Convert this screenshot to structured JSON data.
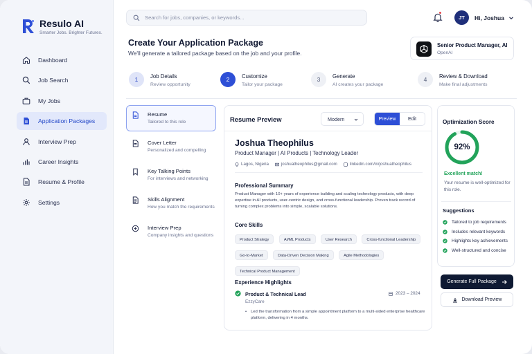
{
  "brand": {
    "name": "Resulo AI",
    "tagline": "Smarter Jobs. Brighter Futures.",
    "accent": "#2e4fd6"
  },
  "nav": [
    {
      "label": "Dashboard",
      "icon": "home-icon"
    },
    {
      "label": "Job Search",
      "icon": "search-icon"
    },
    {
      "label": "My Jobs",
      "icon": "briefcase-icon"
    },
    {
      "label": "Application Packages",
      "icon": "document-icon",
      "active": true
    },
    {
      "label": "Interview Prep",
      "icon": "user-icon"
    },
    {
      "label": "Career Insights",
      "icon": "bar-chart-icon"
    },
    {
      "label": "Resume & Profile",
      "icon": "file-text-icon"
    },
    {
      "label": "Settings",
      "icon": "gear-icon"
    }
  ],
  "header": {
    "search_placeholder": "Search for jobs, companies, or keywords...",
    "avatar_initials": "JT",
    "greeting": "Hi, Joshua"
  },
  "page": {
    "title": "Create Your Application Package",
    "subtitle": "We'll generate a tailored package based on the job and your profile."
  },
  "job": {
    "title": "Senior Product Manager, AI",
    "company": "OpenAI"
  },
  "steps": [
    {
      "number": "1",
      "title": "Job Details",
      "desc": "Review opportunity",
      "state": "done"
    },
    {
      "number": "2",
      "title": "Customize",
      "desc": "Tailor your package",
      "state": "current"
    },
    {
      "number": "3",
      "title": "Generate",
      "desc": "AI creates your package",
      "state": "todo"
    },
    {
      "number": "4",
      "title": "Review & Download",
      "desc": "Make final adjustments",
      "state": "todo"
    }
  ],
  "packages": [
    {
      "title": "Resume",
      "desc": "Tailored to this role",
      "icon": "document-icon"
    },
    {
      "title": "Cover Letter",
      "desc": "Personalized and compelling",
      "icon": "document-icon"
    },
    {
      "title": "Key Talking Points",
      "desc": "For interviews and networking",
      "icon": "bookmark-icon"
    },
    {
      "title": "Skills Alignment",
      "desc": "How you match the requirements",
      "icon": "checklist-icon"
    },
    {
      "title": "Interview Prep",
      "desc": "Company insights and questions",
      "icon": "chat-icon"
    }
  ],
  "preview": {
    "title": "Resume Preview",
    "template": "Modern",
    "toggle_preview": "Preview",
    "toggle_edit": "Edit"
  },
  "resume": {
    "name": "Joshua Theophilus",
    "headline": "Product Manager | AI Products | Technology Leader",
    "location": "Lagos, Nigeria",
    "email": "joshuatheophilus@gmail.com",
    "linkedin": "linkedin.com/in/joshuatheophilus",
    "summary_heading": "Professional Summary",
    "summary": "Product Manager with 10+ years of experience building and scaling technology products, with deep expertise in AI products, user-centric design, and cross-functional leadership. Proven track record of turning complex problems into simple, scalable solutions.",
    "skills_heading": "Core Skills",
    "skills": [
      "Product Strategy",
      "AI/ML Products",
      "User Research",
      "Cross-functional Leadership",
      "Go-to-Market",
      "Data-Driven Decision Making",
      "Agile Methodologies",
      "Technical Product Management"
    ],
    "experience_heading": "Experience Highlights",
    "experience": {
      "role": "Product & Technical Lead",
      "dates": "2023 – 2024",
      "company": "EzzyCare",
      "bullet": "Led the transformation from a simple appointment platform to a multi-sided enterprise healthcare platform, delivering in 4 months."
    }
  },
  "optimization": {
    "title": "Optimization Score",
    "score": 92,
    "score_label": "92%",
    "status": "Excellent match!",
    "note": "Your resume is well-optimized for this role.",
    "ring_color": "#22a35a",
    "suggestions_heading": "Suggestions",
    "suggestions": [
      "Tailored to job requirements",
      "Includes relevant keywords",
      "Highlights key achievements",
      "Well-structured and concise"
    ]
  },
  "actions": {
    "generate": "Generate Full Package",
    "download": "Download Preview"
  }
}
